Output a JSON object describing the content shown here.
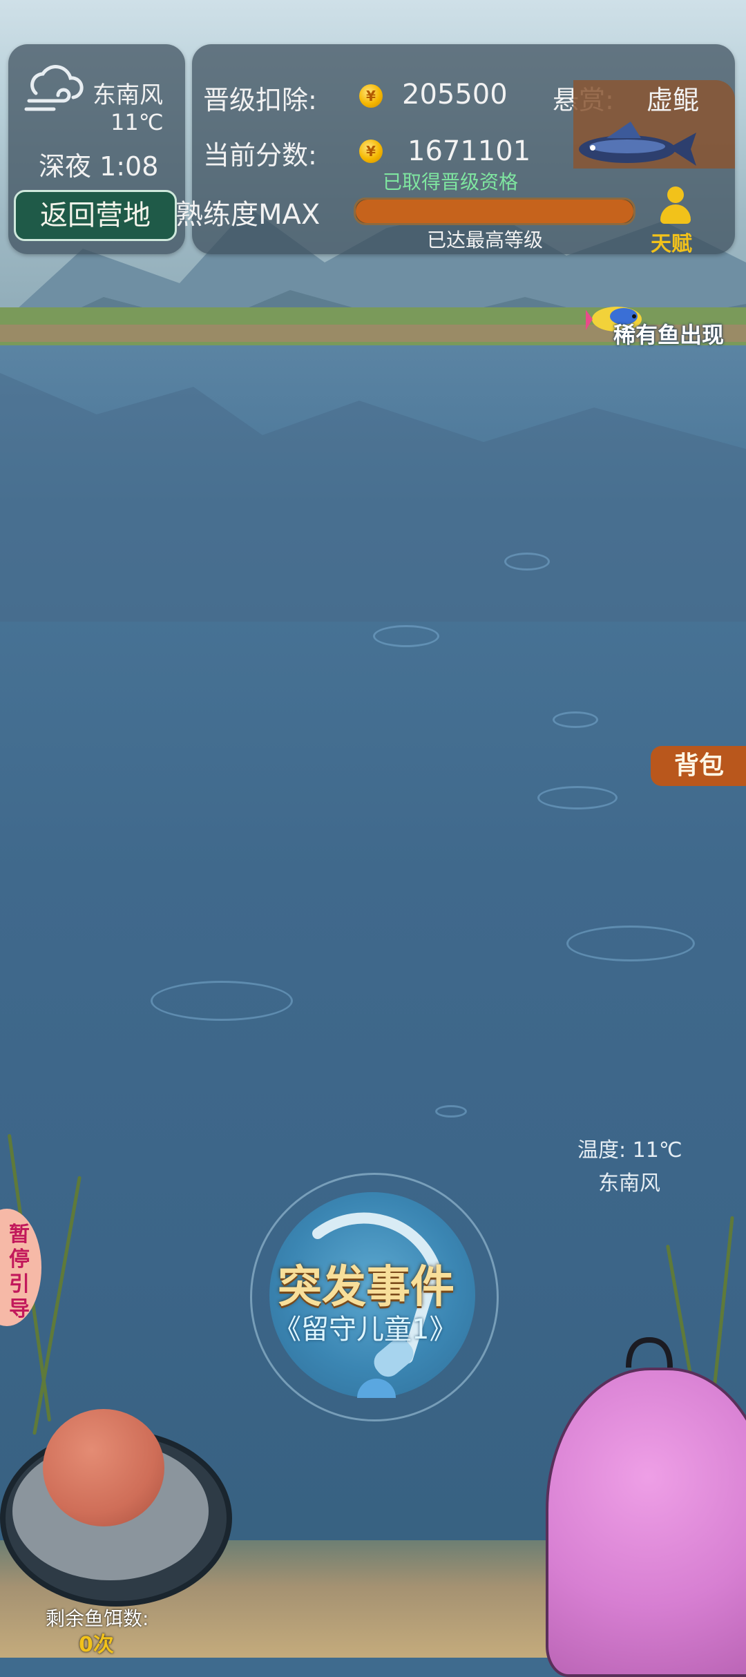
{
  "weather": {
    "wind": "东南风",
    "temperature": "11℃",
    "time": "深夜 1:08"
  },
  "stats": {
    "upgrade_deduct_label": "晋级扣除:",
    "upgrade_deduct_value": "205500",
    "current_score_label": "当前分数:",
    "current_score_value": "1671101",
    "bounty_label": "悬赏:",
    "bounty_fish": "虚鲲",
    "qualified_text": "已取得晋级资格",
    "proficiency_label": "熟练度MAX",
    "max_level_text": "已达最高等级",
    "progress": 1.0,
    "coin_glyph": "¥"
  },
  "buttons": {
    "return_camp": "返回营地",
    "talent": "天赋",
    "bag": "背包"
  },
  "rare_fish_notice": "稀有鱼出现",
  "environment": {
    "temp_label": "温度: 11℃",
    "wind_label": "东南风"
  },
  "event": {
    "title": "突发事件",
    "subtitle": "《留守儿童1》"
  },
  "pause_guide": "暂停引导",
  "bait": {
    "label": "剩余鱼饵数:",
    "count": "0次"
  },
  "colors": {
    "accent_orange": "#c6631c",
    "qualified_green": "#7fe6a0",
    "coin_gold": "#f5b700"
  }
}
